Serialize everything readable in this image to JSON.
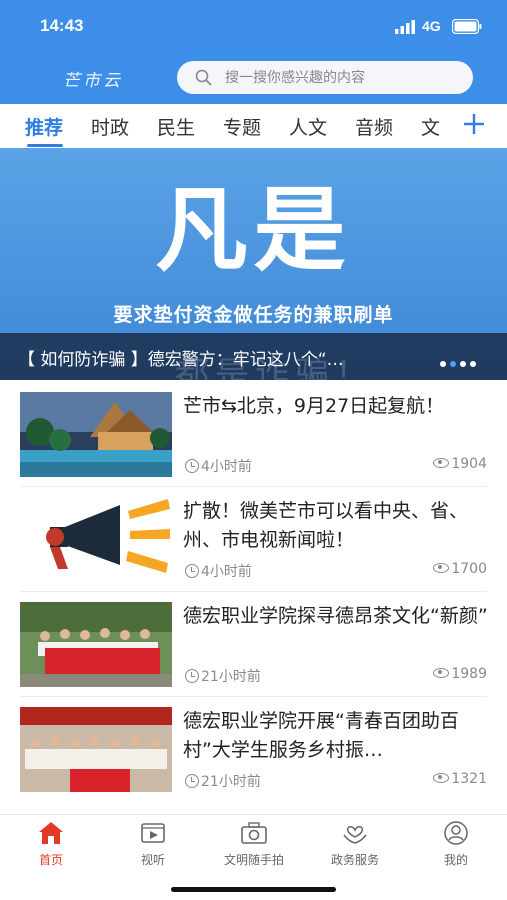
{
  "status_bar": {
    "time": "14:43",
    "network": "4G"
  },
  "header": {
    "logo_text": "芒市云"
  },
  "search": {
    "placeholder": "搜一搜你感兴趣的内容"
  },
  "tabs": [
    {
      "label": "推荐",
      "active": true
    },
    {
      "label": "时政"
    },
    {
      "label": "民生"
    },
    {
      "label": "专题"
    },
    {
      "label": "人文"
    },
    {
      "label": "音频"
    },
    {
      "label": "文"
    }
  ],
  "banner": {
    "headline": "凡是",
    "subtitle": "要求垫付资金做任务的兼职刷单",
    "watermark": "都是诈骗！",
    "caption": "【 如何防诈骗 】德宏警方：牢记这八个“…",
    "slide_count": 4,
    "active_slide": 2
  },
  "news": [
    {
      "title": "芒市⇆北京，9月27日起复航！",
      "time": "4小时前",
      "views": "1904",
      "thumb_icon": "resort-photo"
    },
    {
      "title": "扩散！微美芒市可以看中央、省、州、市电视新闻啦！",
      "time": "4小时前",
      "views": "1700",
      "thumb_icon": "megaphone-icon"
    },
    {
      "title": "德宏职业学院探寻德昂茶文化“新颜”",
      "time": "21小时前",
      "views": "1989",
      "thumb_icon": "group-photo"
    },
    {
      "title": "德宏职业学院开展“青春百团助百村”大学生服务乡村振…",
      "time": "21小时前",
      "views": "1321",
      "thumb_icon": "group-photo"
    }
  ],
  "bottom_nav": [
    {
      "label": "首页",
      "icon": "home-icon",
      "active": true
    },
    {
      "label": "视听",
      "icon": "video-icon"
    },
    {
      "label": "文明随手拍",
      "icon": "camera-icon"
    },
    {
      "label": "政务服务",
      "icon": "heart-hands-icon"
    },
    {
      "label": "我的",
      "icon": "profile-icon"
    }
  ],
  "colors": {
    "accent": "#2f7fe0",
    "header_bg": "#3d8ee8",
    "nav_active": "#e23a2a"
  }
}
